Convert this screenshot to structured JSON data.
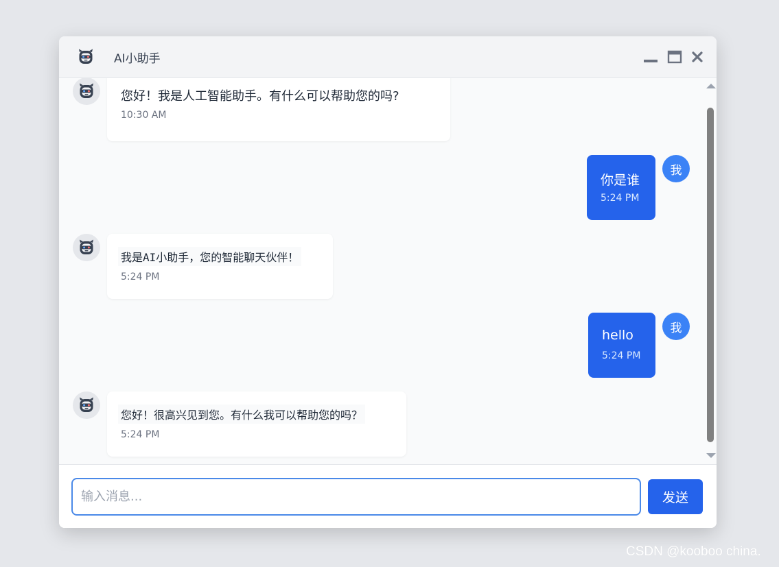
{
  "window": {
    "title": "AI小助手",
    "logo_icon": "robot-icon",
    "controls": [
      "minimize-icon",
      "maximize-icon",
      "close-icon"
    ]
  },
  "messages": [
    {
      "sender": "bot",
      "avatar_icon": "robot-icon",
      "text": "您好！我是人工智能助手。有什么可以帮助您的吗?",
      "time": "10:30 AM"
    },
    {
      "sender": "user",
      "avatar_label": "我",
      "text": "你是谁",
      "time": "5:24 PM"
    },
    {
      "sender": "bot",
      "avatar_icon": "robot-icon",
      "text": "我是AI小助手，您的智能聊天伙伴！",
      "time": "5:24 PM"
    },
    {
      "sender": "user",
      "avatar_label": "我",
      "text": "hello",
      "time": "5:24 PM"
    },
    {
      "sender": "bot",
      "avatar_icon": "robot-icon",
      "text": "您好！很高兴见到您。有什么我可以帮助您的吗？",
      "time": "5:24 PM"
    }
  ],
  "input": {
    "value": "",
    "placeholder": "输入消息..."
  },
  "send_button": {
    "label": "发送"
  },
  "watermark": "CSDN @kooboo china.",
  "colors": {
    "accent": "#2563eb",
    "user_avatar": "#3b82f6",
    "bot_bubble": "#ffffff",
    "page_background": "#e5e7eb"
  }
}
